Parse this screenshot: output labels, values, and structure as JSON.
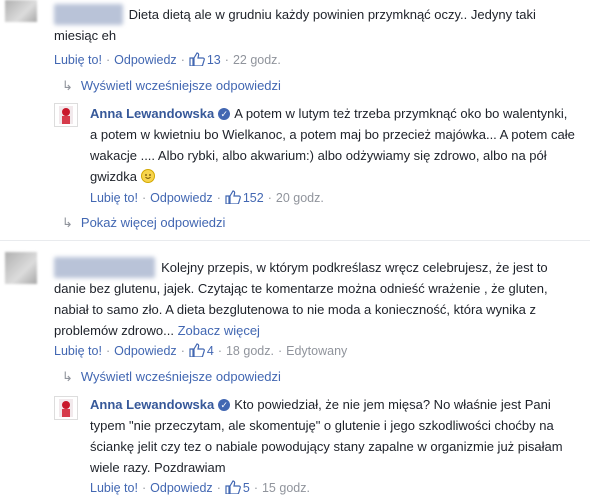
{
  "c1": {
    "text": "Dieta dietą ale w grudniu każdy powinien przymknąć oczy.. Jedyny taki miesiąc eh",
    "like": "Lubię to!",
    "reply": "Odpowiedz",
    "likes": "13",
    "time": "22 godz."
  },
  "c1_prev": "Wyświetl wcześniejsze odpowiedzi",
  "r1": {
    "author": "Anna Lewandowska",
    "text": "A potem w lutym też trzeba przymknąć oko bo walentynki, a potem w kwietniu bo Wielkanoc, a potem maj bo przecież majówka... A potem całe wakacje .... Albo rybki, albo akwarium:) albo odżywiamy się zdrowo, albo na pół gwizdka",
    "like": "Lubię to!",
    "reply": "Odpowiedz",
    "likes": "152",
    "time": "20 godz."
  },
  "c1_more": "Pokaż więcej odpowiedzi",
  "c2": {
    "text": "Kolejny przepis, w którym podkreślasz wręcz celebrujesz, że jest to danie bez glutenu, jajek. Czytając te komentarze można odnieść wrażenie , że gluten, nabiał to samo zło. A dieta bezglutenowa to nie moda a konieczność, która wynika z problemów zdrowo...",
    "see_more": "Zobacz więcej",
    "like": "Lubię to!",
    "reply": "Odpowiedz",
    "likes": "4",
    "time": "18 godz.",
    "edited": "Edytowany"
  },
  "c2_prev": "Wyświetl wcześniejsze odpowiedzi",
  "r2": {
    "author": "Anna Lewandowska",
    "text": "Kto powiedział, że nie jem mięsa? No właśnie jest Pani typem \"nie przeczytam, ale skomentuję\" o glutenie i jego szkodliwości choćby na ściankę jelit czy tez o nabiale powodujący stany zapalne w organizmie już pisałam wiele razy. Pozdrawiam",
    "like": "Lubię to!",
    "reply": "Odpowiedz",
    "likes": "5",
    "time": "15 godz."
  },
  "colors": {
    "link": "#4267b2",
    "author": "#365899",
    "meta": "#90949c",
    "text": "#1d2129"
  },
  "icons": {
    "like": "thumbs-up-icon",
    "verified": "verified-badge-icon",
    "reply_arrow": "reply-arrow-icon",
    "emoji": "smile-emoji-icon"
  }
}
